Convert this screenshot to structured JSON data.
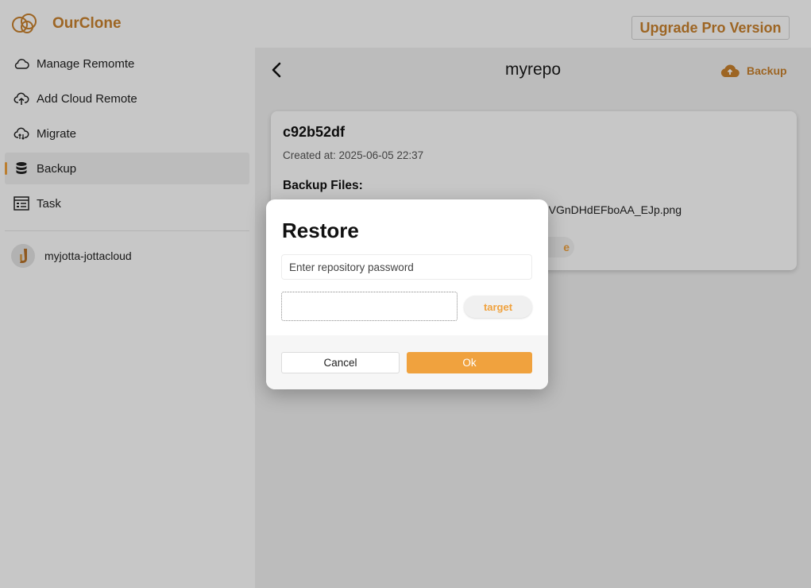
{
  "app": {
    "name": "OurClone",
    "upgrade_label": "Upgrade Pro Version",
    "accent_color": "#f0a23e",
    "brand_color": "#c9822e"
  },
  "sidebar": {
    "items": [
      {
        "label": "Manage Remomte",
        "icon": "cloud-icon"
      },
      {
        "label": "Add Cloud Remote",
        "icon": "cloud-upload-icon"
      },
      {
        "label": "Migrate",
        "icon": "cloud-sync-icon"
      },
      {
        "label": "Backup",
        "icon": "database-icon",
        "active": true
      },
      {
        "label": "Task",
        "icon": "task-list-icon"
      }
    ],
    "remotes": [
      {
        "label": "myjotta-jottacloud",
        "icon": "jottacloud-icon"
      }
    ]
  },
  "main": {
    "title": "myrepo",
    "backup_label": "Backup",
    "snapshot": {
      "id": "c92b52df",
      "created": "Created at: 2025-06-05 22:37",
      "files_label": "Backup Files:",
      "file": "VGnDHdEFboAA_EJp.png",
      "restore_label_partial": "e"
    }
  },
  "dialog": {
    "title": "Restore",
    "password_placeholder": "Enter repository password",
    "target_value": "",
    "target_label": "target",
    "cancel_label": "Cancel",
    "ok_label": "Ok"
  }
}
